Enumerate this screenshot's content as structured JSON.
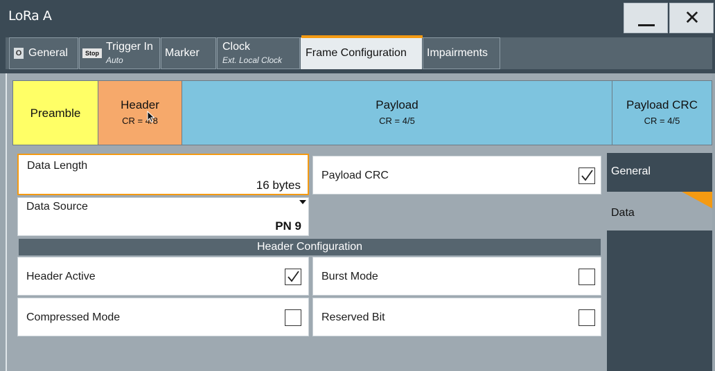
{
  "window": {
    "title": "LoRa A",
    "minimize_icon": "minimize-icon",
    "close_label": "✕"
  },
  "tabs": [
    {
      "label": "General",
      "sub": "",
      "icon": "status-square-icon",
      "icon_text": "O"
    },
    {
      "label": "Trigger In",
      "sub": "Auto",
      "icon": "stop-badge-icon",
      "icon_text": "Stop"
    },
    {
      "label": "Marker",
      "sub": ""
    },
    {
      "label": "Clock",
      "sub": "Ext. Local Clock"
    },
    {
      "label": "Frame Configuration",
      "sub": "",
      "active": true
    },
    {
      "label": "Impairments",
      "sub": ""
    }
  ],
  "frame": {
    "preamble": {
      "label": "Preamble",
      "color": "#ffff66"
    },
    "header": {
      "label": "Header",
      "cr": "CR = 4/8",
      "color": "#f6a96b"
    },
    "payload": {
      "label": "Payload",
      "cr": "CR = 4/5",
      "color": "#7ec4df"
    },
    "crc": {
      "label": "Payload CRC",
      "cr": "CR = 4/5",
      "color": "#7ec4df"
    }
  },
  "fields": {
    "data_length": {
      "label": "Data Length",
      "value": "16 bytes"
    },
    "payload_crc": {
      "label": "Payload CRC",
      "checked": true
    },
    "data_source": {
      "label": "Data Source",
      "value": "PN 9"
    }
  },
  "header_config": {
    "title": "Header Configuration",
    "header_active": {
      "label": "Header Active",
      "checked": true
    },
    "burst_mode": {
      "label": "Burst Mode",
      "checked": false
    },
    "compressed_mode": {
      "label": "Compressed Mode",
      "checked": false
    },
    "reserved_bit": {
      "label": "Reserved Bit",
      "checked": false
    }
  },
  "sidenav": {
    "items": [
      {
        "label": "General"
      },
      {
        "label": "Data",
        "active": true
      }
    ]
  },
  "colors": {
    "accent": "#f49a12",
    "titlebar": "#3b4a55"
  }
}
